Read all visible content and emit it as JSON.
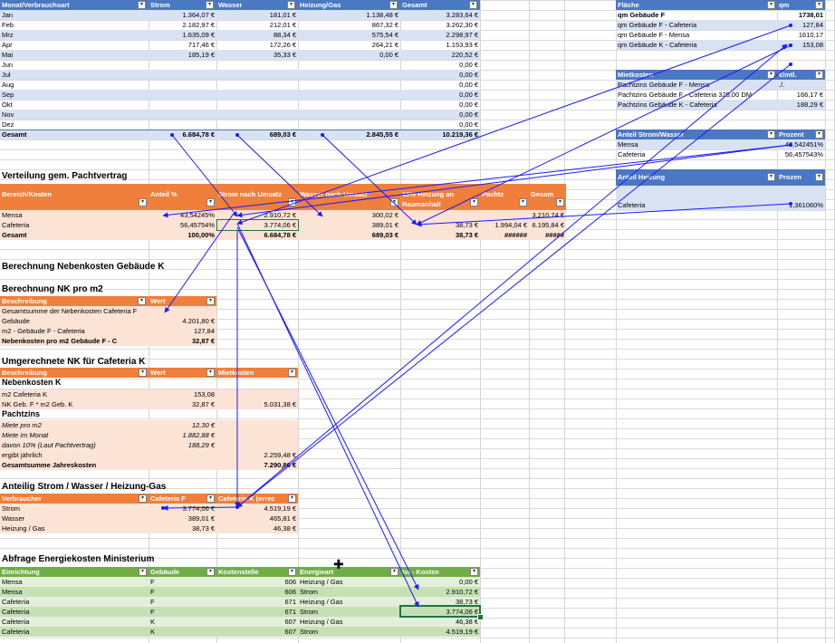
{
  "table1": {
    "headers": [
      "Monat/Verbrauchsart",
      "Strom",
      "Wasser",
      "Heizung/Gas",
      "Gesamt"
    ],
    "rows": [
      [
        "Jan",
        "1.364,07 €",
        "181,01 €",
        "1.138,48 €",
        "3.283,64 €"
      ],
      [
        "Feb",
        "2.182,97 €",
        "212,01 €",
        "867,32 €",
        "3.262,30 €"
      ],
      [
        "Mrz",
        "1.635,09 €",
        "88,34 €",
        "575,54 €",
        "2.298,97 €"
      ],
      [
        "Apr",
        "717,46 €",
        "172,26 €",
        "264,21 €",
        "1.153,93 €"
      ],
      [
        "Mai",
        "185,19 €",
        "35,33 €",
        "0,00 €",
        "220,52 €"
      ],
      [
        "Jun",
        "",
        "",
        "",
        "0,00 €"
      ],
      [
        "Jul",
        "",
        "",
        "",
        "0,00 €"
      ],
      [
        "Aug",
        "",
        "",
        "",
        "0,00 €"
      ],
      [
        "Sep",
        "",
        "",
        "",
        "0,00 €"
      ],
      [
        "Okt",
        "",
        "",
        "",
        "0,00 €"
      ],
      [
        "Nov",
        "",
        "",
        "",
        "0,00 €"
      ],
      [
        "Dez",
        "",
        "",
        "",
        "0,00 €"
      ]
    ],
    "total": [
      "Gesamt",
      "6.684,78 €",
      "689,03 €",
      "2.845,55 €",
      "10.219,36 €"
    ]
  },
  "verteilung": {
    "title": "Verteilung gem. Pachtvertrag",
    "headers": [
      "Bereich/Kosten",
      "Anteil %",
      "Strom nach Umsatz",
      "Wasser nach Umsatz",
      "10% Heizung an Raumanhalt",
      "Pachtz",
      "Gesam"
    ],
    "rows": [
      [
        "Mensa",
        "43,54245%",
        "2.910,72 €",
        "300,02 €",
        "",
        "",
        "3.210,74 €"
      ],
      [
        "Cafeteria",
        "56,45754%",
        "3.774,06 €",
        "389,01 €",
        "38,73 €",
        "1.994,04 €",
        "6.195,84 €"
      ]
    ],
    "total": [
      "Gesamt",
      "100,00%",
      "6.684,78 €",
      "689,03 €",
      "38,73 €",
      "######",
      "#####"
    ]
  },
  "berechnung_title": "Berechnung Nebenkosten Gebäude K",
  "nk_pro_m2": {
    "title": "Berechnung NK pro m2",
    "headers": [
      "Beschreibung",
      "Wert"
    ],
    "rows": [
      [
        "Gesamtsumme der Nebenkosten Cafeteria F",
        ""
      ],
      [
        "Gebäude",
        "4.201,80 €"
      ],
      [
        "m2 - Gebäude F - Cafeteria",
        "127,84"
      ]
    ],
    "total": [
      "Nebenkosten pro m2 Gebäude F - C",
      "32,87 €"
    ]
  },
  "umgerechnet": {
    "title": "Umgerechnete NK für Cafeteria K",
    "headers": [
      "Beschreibung",
      "Wert",
      "Mietkosten"
    ],
    "sub1": "Nebenkosten K",
    "rows1": [
      [
        "m2 Cafeteria K",
        "153,08",
        ""
      ],
      [
        "NK Geb. F * m2 Geb. K",
        "32,87 €",
        "5.031,38 €"
      ]
    ],
    "sub2": "Pachtzins",
    "rows2": [
      [
        "Miete pro m2",
        "12,30 €",
        ""
      ],
      [
        "Miete im Monat",
        "1.882,88 €",
        ""
      ],
      [
        "davon 10% (Laut Pachtvertrag)",
        "188,29 €",
        ""
      ],
      [
        "ergibt jährlich",
        "",
        "2.259,48 €"
      ]
    ],
    "total": [
      "Gesamtsumme Jahreskosten",
      "",
      "7.290,86 €"
    ]
  },
  "anteilig": {
    "title": "Anteilig Strom / Wasser / Heizung-Gas",
    "headers": [
      "Verbraucher",
      "Cafeteria F",
      "Cafeteria K (errec"
    ],
    "rows": [
      [
        "Strom",
        "3.774,06 €",
        "4.519,19 €"
      ],
      [
        "Wasser",
        "389,01 €",
        "465,81 €"
      ],
      [
        "Heizung / Gas",
        "38,73 €",
        "46,38 €"
      ]
    ]
  },
  "abfrage": {
    "title": "Abfrage Energiekosten Ministerium",
    "headers": [
      "Einrichtung",
      "Gebäude",
      "Kostenstelle",
      "Energieart",
      "Ist - Kosten"
    ],
    "rows": [
      [
        "Mensa",
        "F",
        "606",
        "Heizung / Gas",
        "0,00 €"
      ],
      [
        "Mensa",
        "F",
        "606",
        "Strom",
        "2.910,72 €"
      ],
      [
        "Cafeteria",
        "F",
        "671",
        "Heizung / Gas",
        "38,73 €"
      ],
      [
        "Cafeteria",
        "F",
        "671",
        "Strom",
        "3.774,06 €"
      ],
      [
        "Cafeteria",
        "K",
        "607",
        "Heizung / Gas",
        "46,38 €"
      ],
      [
        "Cafeteria",
        "K",
        "607",
        "Strom",
        "4.519,19 €"
      ]
    ]
  },
  "flaeche": {
    "headers": [
      "Fläche",
      "qm"
    ],
    "first": [
      "qm Gebäude F",
      "1738,01"
    ],
    "rows": [
      [
        "qm Gebäude F - Cafeteria",
        "127,84"
      ],
      [
        "qm Gebäude F - Mensa",
        "1610,17"
      ],
      [
        "qm Gebäude K - Cafeteria",
        "153,08"
      ]
    ]
  },
  "mietkosten": {
    "headers": [
      "Mietkosten",
      "€/mtl."
    ],
    "rows": [
      [
        "Pachtzins Gebäude F - Mensa",
        "./."
      ],
      [
        "Pachtzins Gebäude F - Cafeteria 325,00 DM",
        "166,17 €"
      ],
      [
        "Pachtzins Gebäude K - Cafeteria",
        "188,29 €"
      ]
    ]
  },
  "anteil_sw": {
    "headers": [
      "Anteil Strom/Wasser",
      "Prozent"
    ],
    "rows": [
      [
        "Mensa",
        "43,542451%"
      ],
      [
        "Cafeteria",
        "56,457543%"
      ]
    ]
  },
  "anteil_heizung": {
    "headers": [
      "Anteil Heizung",
      "Prozen"
    ],
    "rows": [
      [
        "Cafeteria",
        "1,361060%"
      ]
    ]
  },
  "colors": {
    "blue": "#4a78c2",
    "orange": "#ef7f3b",
    "green": "#70ad47",
    "arrow": "#1a1aff"
  }
}
